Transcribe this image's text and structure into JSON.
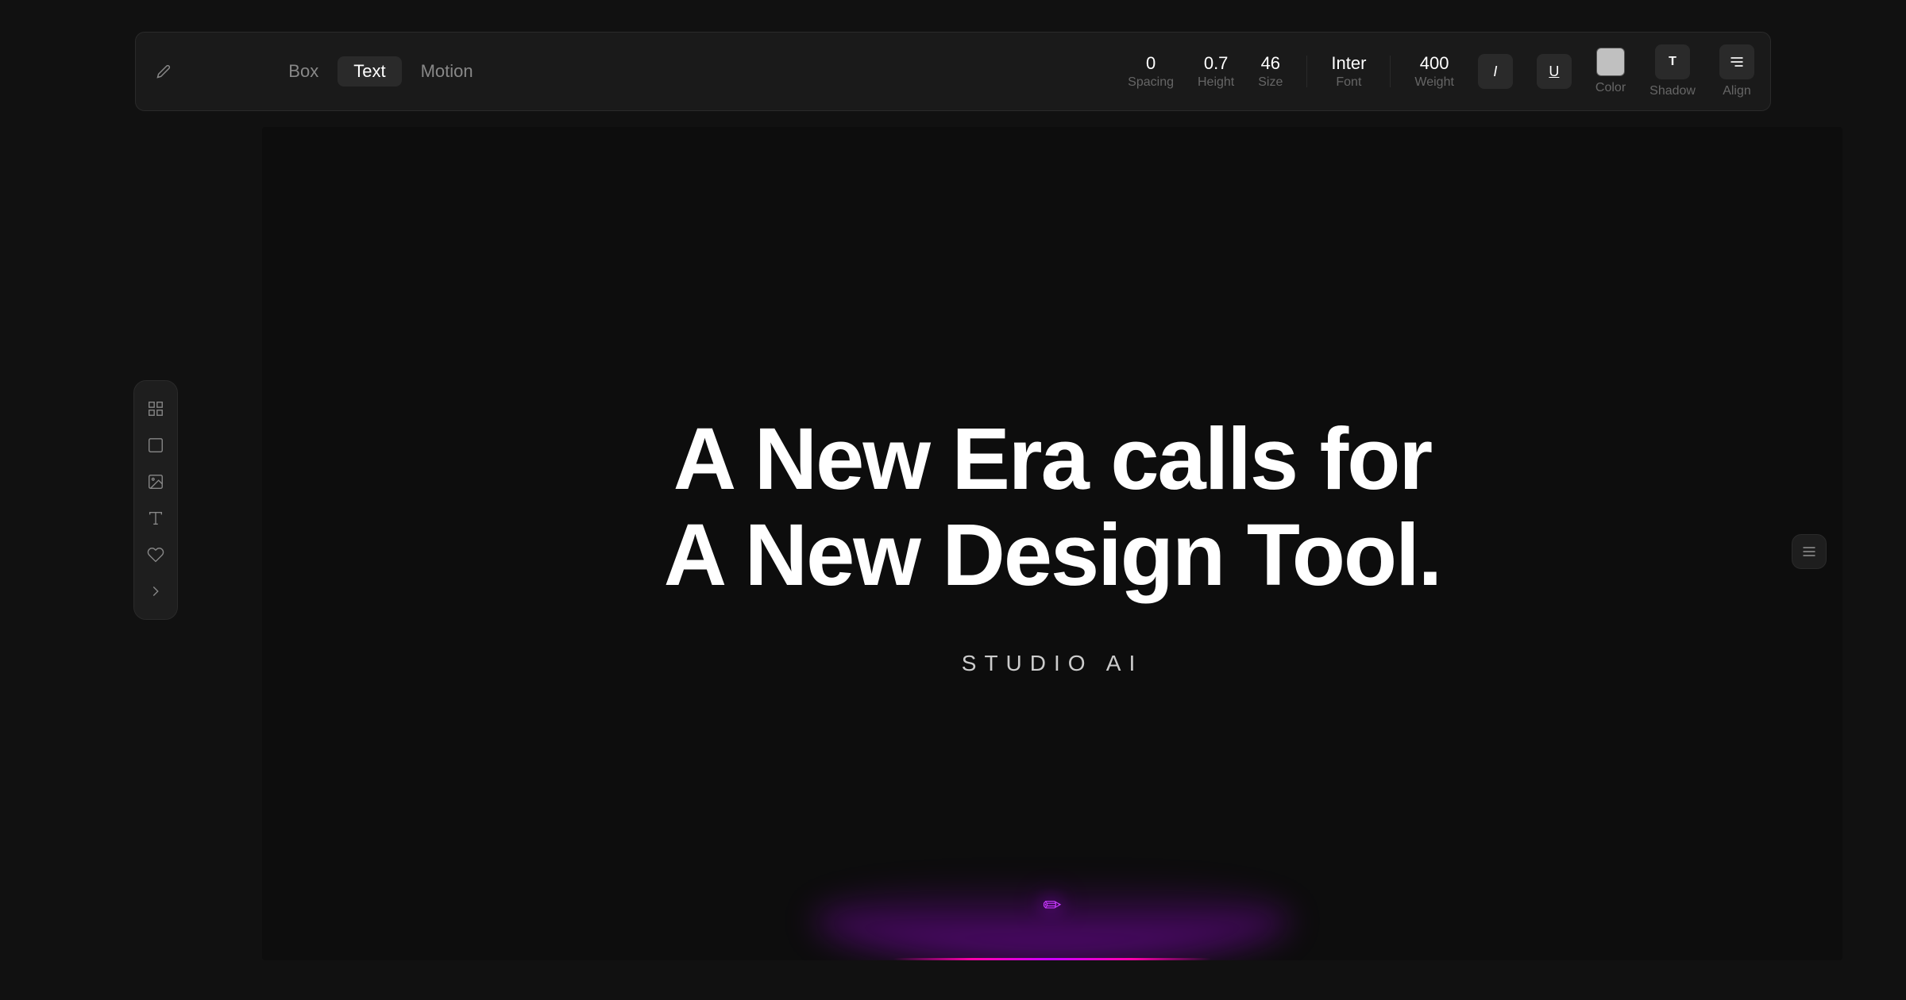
{
  "toolbar": {
    "pencil_icon": "✏",
    "tabs": [
      {
        "label": "Box",
        "active": false
      },
      {
        "label": "Text",
        "active": true
      },
      {
        "label": "Motion",
        "active": false
      }
    ],
    "spacing": {
      "value": "0",
      "label": "Spacing"
    },
    "height": {
      "value": "0.7",
      "label": "Height"
    },
    "size": {
      "value": "46",
      "label": "Size"
    },
    "font": {
      "value": "Inter",
      "label": "Font"
    },
    "weight": {
      "value": "400",
      "label": "Weight"
    },
    "italic_label": "Italic",
    "underline_label": "Underline",
    "color_label": "Color",
    "shadow_label": "Shadow",
    "align_label": "Align"
  },
  "sidebar": {
    "icons": [
      {
        "name": "frame-icon",
        "label": "Frame"
      },
      {
        "name": "box-icon",
        "label": "Box"
      },
      {
        "name": "image-icon",
        "label": "Image"
      },
      {
        "name": "text-icon",
        "label": "Text"
      },
      {
        "name": "heart-icon",
        "label": "Heart"
      },
      {
        "name": "chevron-right-icon",
        "label": "More"
      }
    ]
  },
  "canvas": {
    "hero_line1": "A New Era calls for",
    "hero_line2": "A New Design Tool.",
    "studio_ai": "STUDIO AI",
    "background_color": "#0d0d0d"
  },
  "right_panel": {
    "icon": "≡"
  }
}
